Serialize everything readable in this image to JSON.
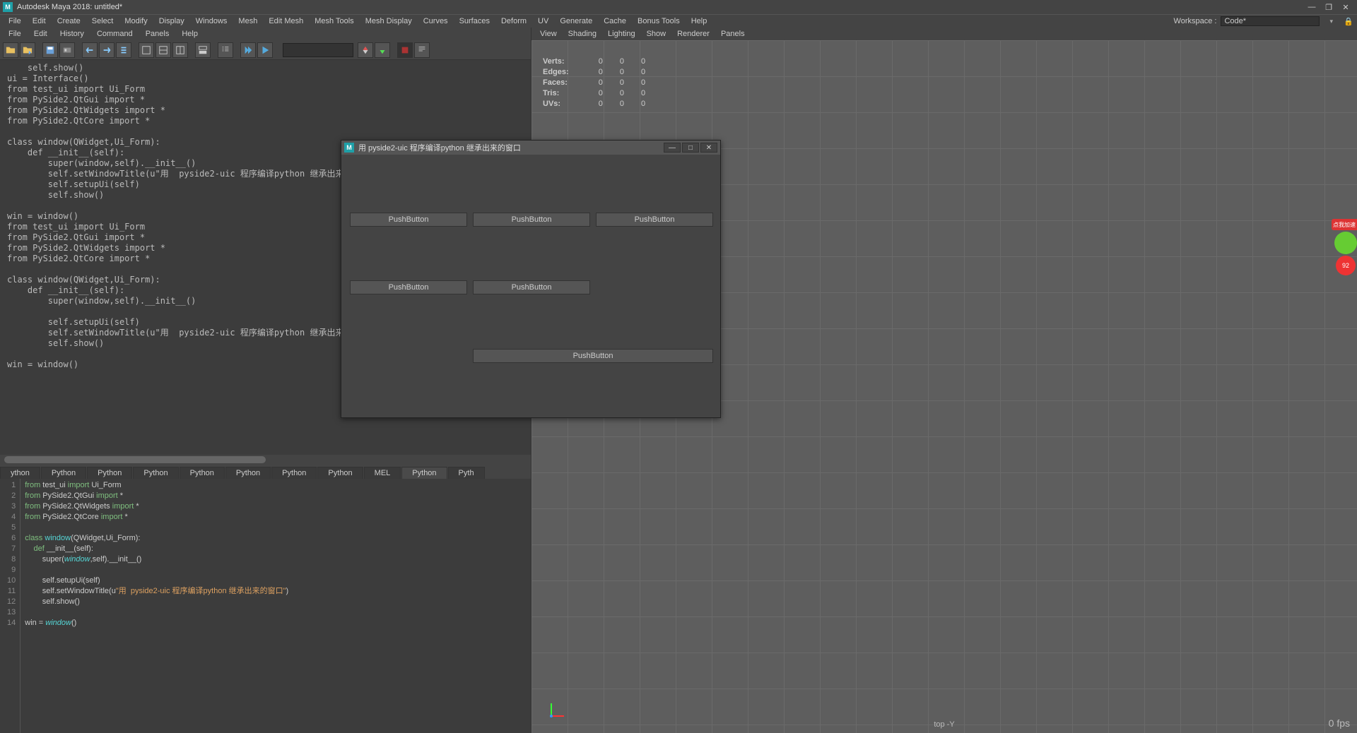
{
  "app": {
    "title": "Autodesk Maya 2018: untitled*"
  },
  "winctrl": {
    "min": "—",
    "max": "❐",
    "close": "✕"
  },
  "mainmenu": [
    "File",
    "Edit",
    "Create",
    "Select",
    "Modify",
    "Display",
    "Windows",
    "Mesh",
    "Edit Mesh",
    "Mesh Tools",
    "Mesh Display",
    "Curves",
    "Surfaces",
    "Deform",
    "UV",
    "Generate",
    "Cache",
    "Bonus Tools",
    "Help"
  ],
  "workspace": {
    "label": "Workspace :",
    "value": "Code*"
  },
  "sc_menu": [
    "File",
    "Edit",
    "History",
    "Command",
    "Panels",
    "Help"
  ],
  "vp_menu": [
    "View",
    "Shading",
    "Lighting",
    "Show",
    "Renderer",
    "Panels"
  ],
  "hud": {
    "rows": [
      {
        "label": "Verts:",
        "a": "0",
        "b": "0",
        "c": "0"
      },
      {
        "label": "Edges:",
        "a": "0",
        "b": "0",
        "c": "0"
      },
      {
        "label": "Faces:",
        "a": "0",
        "b": "0",
        "c": "0"
      },
      {
        "label": "Tris:",
        "a": "0",
        "b": "0",
        "c": "0"
      },
      {
        "label": "UVs:",
        "a": "0",
        "b": "0",
        "c": "0"
      }
    ]
  },
  "viewport": {
    "label": "top -Y",
    "fps": "0 fps"
  },
  "history_text": "    self.show()\nui = Interface()\nfrom test_ui import Ui_Form\nfrom PySide2.QtGui import *\nfrom PySide2.QtWidgets import *\nfrom PySide2.QtCore import *\n\nclass window(QWidget,Ui_Form):\n    def __init__(self):\n        super(window,self).__init__()\n        self.setWindowTitle(u\"用  pyside2-uic 程序编译python 继承出来的窗口\")\n        self.setupUi(self)\n        self.show()\n\nwin = window()\nfrom test_ui import Ui_Form\nfrom PySide2.QtGui import *\nfrom PySide2.QtWidgets import *\nfrom PySide2.QtCore import *\n\nclass window(QWidget,Ui_Form):\n    def __init__(self):\n        super(window,self).__init__()\n\n        self.setupUi(self)\n        self.setWindowTitle(u\"用  pyside2-uic 程序编译python 继承出来的窗口\")\n        self.show()\n\nwin = window()",
  "tabs": [
    "ython",
    "Python",
    "Python",
    "Python",
    "Python",
    "Python",
    "Python",
    "Python",
    "MEL",
    "Python",
    "Pyth"
  ],
  "code_lines": [
    {
      "n": 1,
      "html": "<span class='kw'>from</span> test_ui <span class='kw'>import</span> Ui_Form"
    },
    {
      "n": 2,
      "html": "<span class='kw'>from</span> PySide2.QtGui <span class='kw'>import</span> *"
    },
    {
      "n": 3,
      "html": "<span class='kw'>from</span> PySide2.QtWidgets <span class='kw'>import</span> *"
    },
    {
      "n": 4,
      "html": "<span class='kw'>from</span> PySide2.QtCore <span class='kw'>import</span> *"
    },
    {
      "n": 5,
      "html": ""
    },
    {
      "n": 6,
      "html": "<span class='kw'>class</span> <span class='cls'>window</span>(QWidget,Ui_Form):"
    },
    {
      "n": 7,
      "html": "    <span class='kw'>def</span> __init__(self):"
    },
    {
      "n": 8,
      "html": "        super(<span class='fn'>window</span>,self).__init__()"
    },
    {
      "n": 9,
      "html": ""
    },
    {
      "n": 10,
      "html": "        self.setupUi(self)"
    },
    {
      "n": 11,
      "html": "        self.setWindowTitle(u<span class='str2'>\"用  pyside2-uic 程序编译python 继承出来的窗口\"</span>)"
    },
    {
      "n": 12,
      "html": "        self.show()"
    },
    {
      "n": 13,
      "html": ""
    },
    {
      "n": 14,
      "html": "win = <span class='fn'>window</span>()"
    }
  ],
  "pywin": {
    "title": "用 pyside2-uic 程序编译python 继承出来的窗口",
    "btn": "PushButton"
  },
  "sidewidget": {
    "red": "点我加速",
    "circ": "92"
  }
}
